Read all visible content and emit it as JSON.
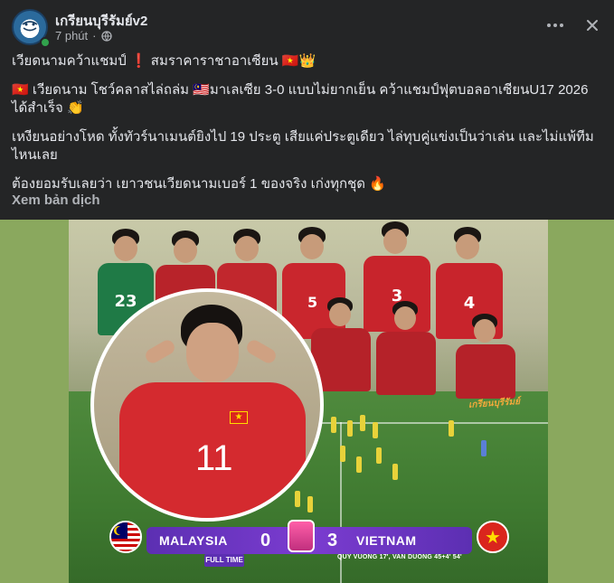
{
  "header": {
    "page_name": "เกรียนบุรีรัมย์v2",
    "time": "7 phút",
    "separator": "·",
    "audience_icon": "globe-icon",
    "more_icon": "more-horizontal-icon",
    "close_icon": "close-icon"
  },
  "post": {
    "line1": "เวียดนามคว้าแชมป์ ❗ สมราคาราชาอาเซียน 🇻🇳👑",
    "line2": "🇻🇳 เวียดนาม โชว์คลาสไล่ถล่ม 🇲🇾มาเลเซีย 3-0 แบบไม่ยากเย็น คว้าแชมป์ฟุตบอลอาเซียนU17 2026 ได้สำเร็จ 👏",
    "line3": "เหงียนอย่างโหด ทั้งทัวร์นาเมนต์ยิงไป 19 ประตู เสียแค่ประตูเดียว ไล่ทุบคู่แข่งเป็นว่าเล่น และไม่แพ้ทีมไหนเลย",
    "line4": "ต้องยอมรับเลยว่า เยาวชนเวียดนามเบอร์ 1 ของจริง เก่งทุกชุด 🔥",
    "see_translation": "Xem bản dịch"
  },
  "image": {
    "watermark": "เกรียนบุรีรัมย์",
    "score": {
      "team_left": "MALAYSIA",
      "score_left": "0",
      "score_right": "3",
      "team_right": "VIETNAM",
      "status": "FULL TIME",
      "scorers": "QUY VUONG 17', VAN DUONG 45+4' 54'"
    },
    "shirt_numbers": [
      "23",
      "3",
      "5",
      "4",
      "11"
    ]
  },
  "colors": {
    "background": "#242526",
    "text_primary": "#e4e6eb",
    "text_secondary": "#b0b3b8",
    "online": "#31a24c",
    "scorebar": "#6a35c2",
    "vietnam_red": "#da251d"
  }
}
